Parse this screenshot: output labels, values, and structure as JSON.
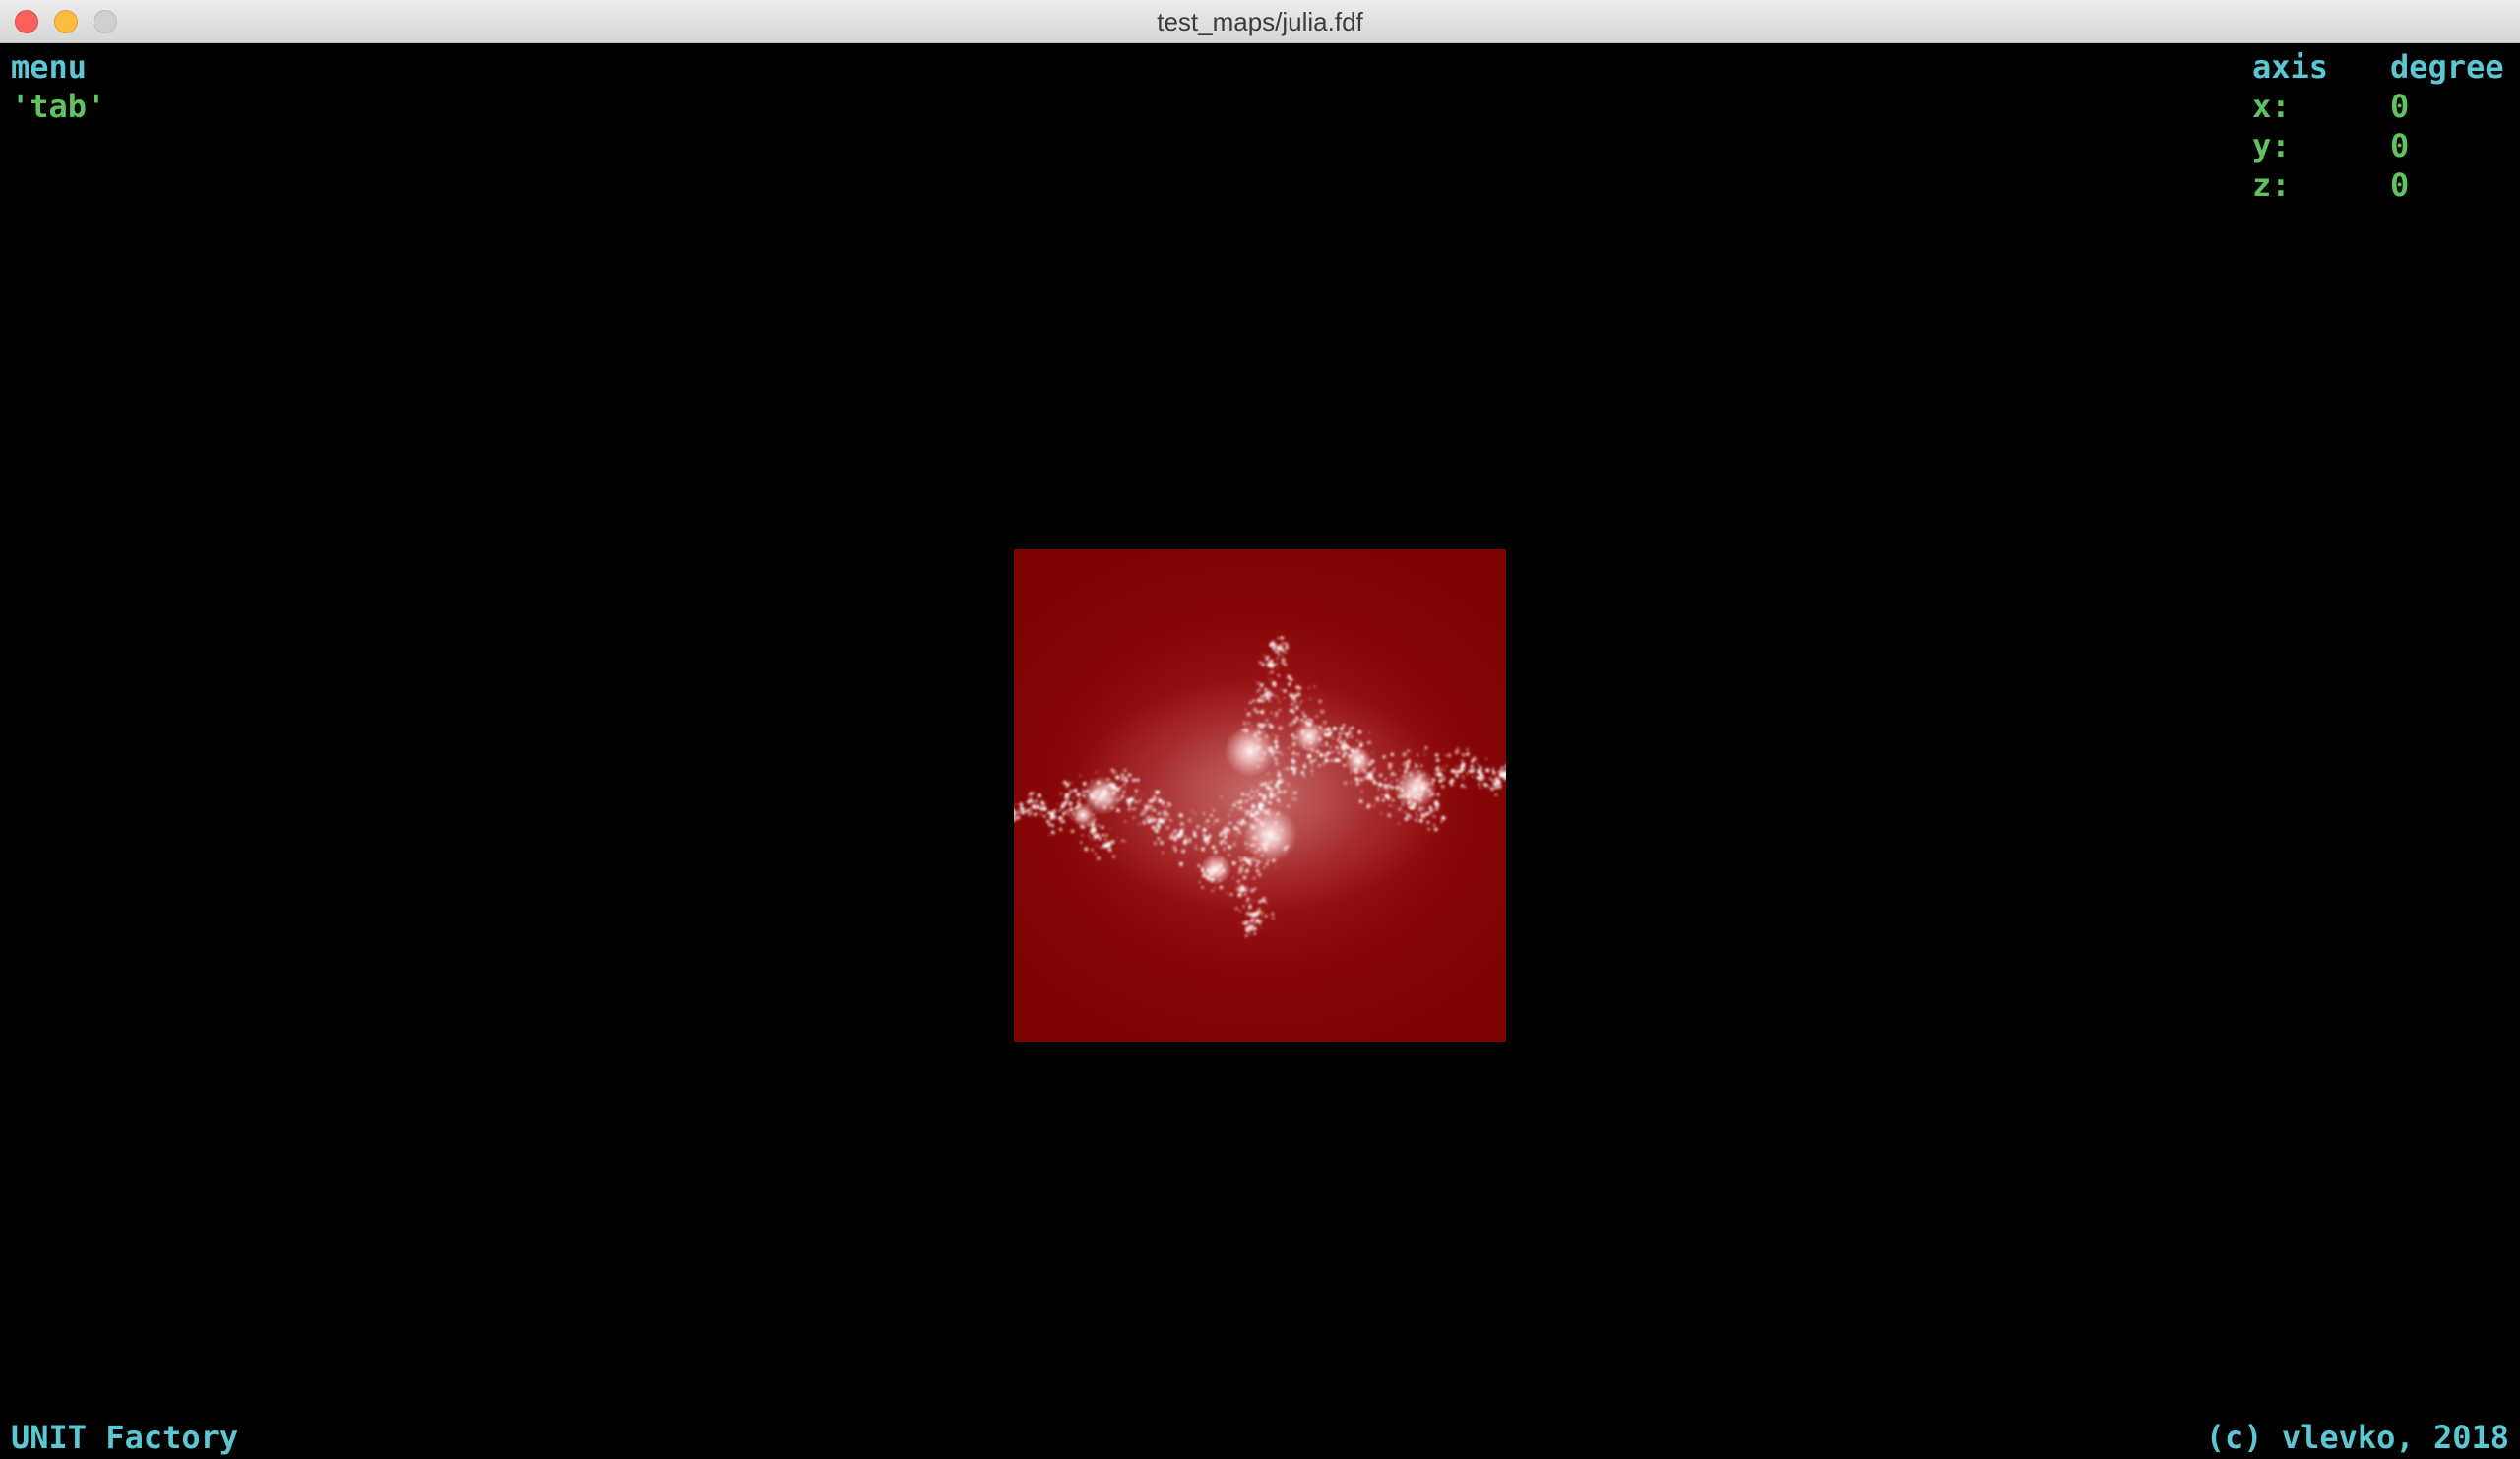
{
  "window": {
    "title": "test_maps/julia.fdf"
  },
  "menu": {
    "label": "menu",
    "hint": "'tab'"
  },
  "rotation": {
    "header_axis": "axis",
    "header_degree": "degree",
    "rows": [
      {
        "axis": "x:",
        "degree": "0"
      },
      {
        "axis": "y:",
        "degree": "0"
      },
      {
        "axis": "z:",
        "degree": "0"
      }
    ]
  },
  "footer": {
    "left": "UNIT Factory",
    "right": "(c) vlevko, 2018"
  },
  "colors": {
    "label_cyan": "#5bc7d3",
    "value_green": "#5fc35f",
    "background": "#000000",
    "fractal_red": "#7d0303"
  }
}
